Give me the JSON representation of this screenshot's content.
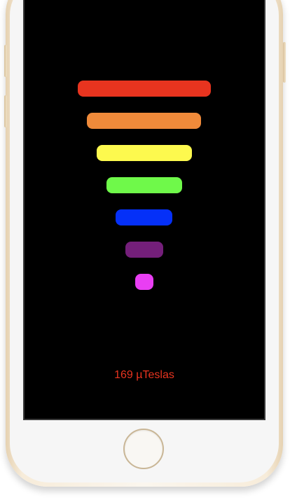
{
  "meter": {
    "readout_value": "169",
    "readout_unit": "µTeslas",
    "readout_color": "#e8341f",
    "bars": [
      {
        "color": "#e8341f"
      },
      {
        "color": "#ef8a3a"
      },
      {
        "color": "#fdf94e"
      },
      {
        "color": "#6ff94a"
      },
      {
        "color": "#0530f8"
      },
      {
        "color": "#741f7a"
      },
      {
        "color": "#e93ef3"
      }
    ]
  }
}
